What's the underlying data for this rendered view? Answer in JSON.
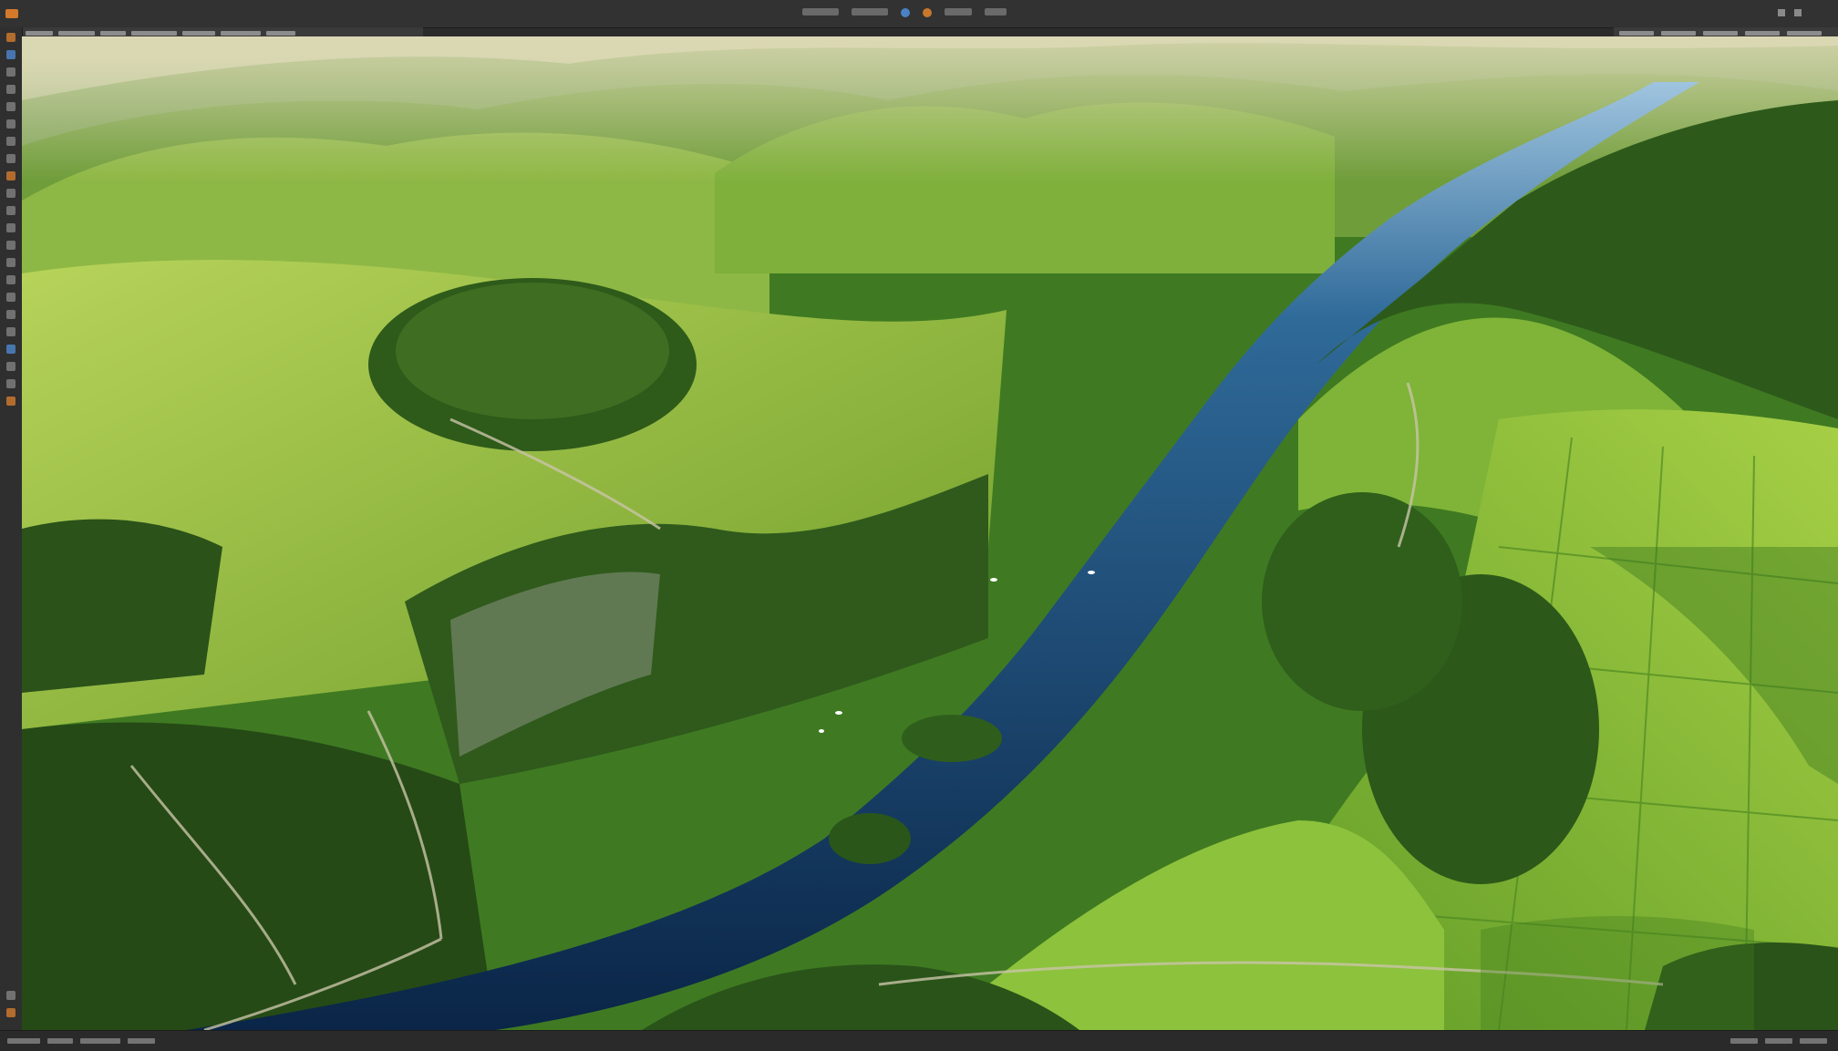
{
  "colors": {
    "chrome_dark": "#2b2b2b",
    "menubar": "#323232",
    "accent_orange": "#d47a2a",
    "accent_blue": "#4b82c6",
    "river": "#0e2f55",
    "meadow": "#8fc43a",
    "forest": "#1f4a18"
  },
  "menubar": {
    "items": [
      "",
      "",
      "",
      "",
      "",
      "",
      "",
      ""
    ]
  },
  "toolbar": {
    "tools": [
      "move-tool-icon",
      "marquee-tool-icon",
      "lasso-tool-icon",
      "crop-tool-icon",
      "eyedropper-tool-icon",
      "healing-tool-icon",
      "brush-tool-icon",
      "stamp-tool-icon",
      "history-brush-icon",
      "eraser-tool-icon",
      "gradient-tool-icon",
      "blur-tool-icon",
      "dodge-tool-icon",
      "pen-tool-icon",
      "type-tool-icon",
      "path-select-icon",
      "shape-tool-icon",
      "hand-tool-icon",
      "zoom-tool-icon"
    ]
  },
  "canvas": {
    "image_subject": ""
  }
}
